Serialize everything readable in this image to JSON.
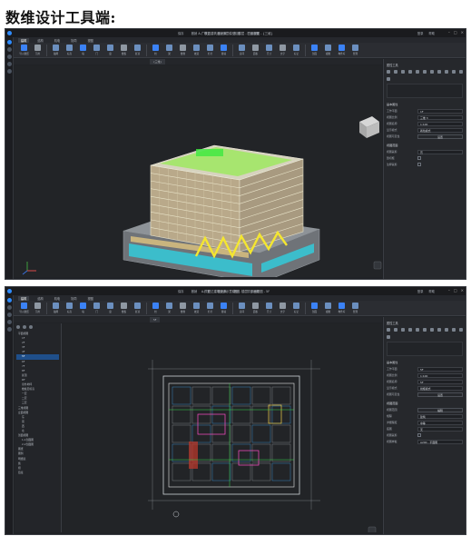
{
  "heading": "数维设计工具端:",
  "window_title": "A-广联达建筑设计示意模型 - 楼层 - 三维视图 - {三维}",
  "window_title_2": "A-广联达建筑设计示意模型 - 楼层 - 平面视图 - 5F",
  "quick_tools": [
    "保存",
    "撤销",
    "恢复",
    "图纸集",
    "视图",
    "项目设置"
  ],
  "user_items": [
    "登录",
    "帮助"
  ],
  "ribbon_tabs": [
    "建筑",
    "结构",
    "机电",
    "协同",
    "视图"
  ],
  "ribbon_tools": [
    "导入图纸",
    "引用",
    "轴网",
    "标高",
    "墙",
    "门",
    "窗",
    "楼板",
    "屋顶",
    "柱",
    "梁",
    "楼梯",
    "坡道",
    "栏杆",
    "幕墙",
    "房间",
    "面积",
    "尺寸",
    "文字",
    "标记",
    "剖面",
    "视图",
    "构件库",
    "管理"
  ],
  "doc_tab_1": "{三维}",
  "doc_tab_2": "5F",
  "panel": {
    "title": "属性工具",
    "section": "基本属性",
    "s2": "视图范围",
    "rows1": [
      {
        "k": "工作平面",
        "v": "1F"
      },
      {
        "k": "视图比例",
        "v": "三维 3"
      },
      {
        "k": "视图名称",
        "v": "1:100"
      },
      {
        "k": "显示模式",
        "v": "着色模式"
      },
      {
        "k": "视图可见性",
        "v": "设置"
      }
    ],
    "rows2": [
      {
        "k": "视图裁剪",
        "v": "否"
      }
    ],
    "rows2b": [
      {
        "k": "剖切框",
        "v": ""
      },
      {
        "k": "注释裁剪",
        "v": ""
      }
    ],
    "rows3": [
      {
        "k": "工作平面",
        "v": "5F"
      },
      {
        "k": "视图比例",
        "v": "1:100"
      },
      {
        "k": "视图名称",
        "v": "5F"
      },
      {
        "k": "显示模式",
        "v": "线框模式"
      },
      {
        "k": "视图可见性",
        "v": "设置"
      }
    ],
    "rows4": [
      {
        "k": "视图范围",
        "v": "编辑"
      },
      {
        "k": "规程",
        "v": "建筑"
      },
      {
        "k": "详细程度",
        "v": "中等"
      },
      {
        "k": "底图",
        "v": "无"
      },
      {
        "k": "视图裁剪",
        "v": ""
      },
      {
        "k": "视图样板",
        "v": "A200 - 平面图"
      }
    ]
  },
  "tree": [
    "平面视图",
    "1F",
    "2F",
    "3F",
    "4F",
    "5F",
    "6F",
    "7F",
    "8F",
    "屋顶",
    "RF",
    "室外地坪",
    "楼板层标高",
    "一层",
    "二层",
    "三层",
    "三维视图",
    "立面视图",
    "东",
    "南",
    "西",
    "北",
    "剖面视图",
    "1-1剖面图",
    "2-2剖面图",
    "图纸",
    "图例",
    "明细表",
    "族",
    "组",
    "链接"
  ]
}
